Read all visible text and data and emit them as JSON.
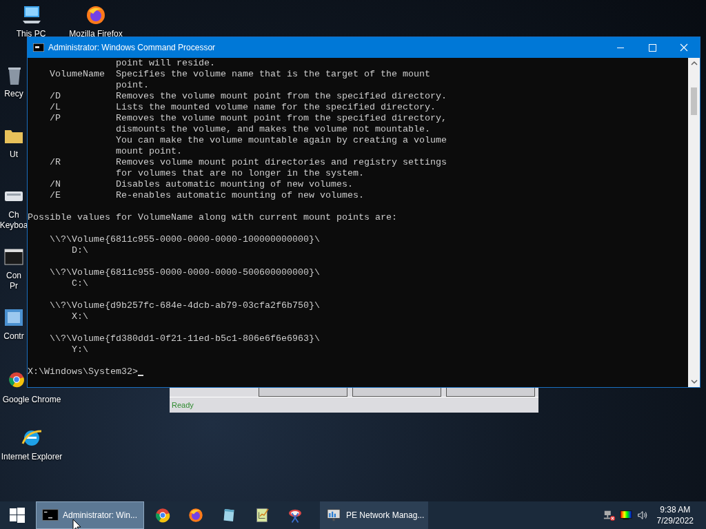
{
  "desktop_icons": [
    {
      "kind": "computer",
      "lines": [
        "This PC"
      ]
    },
    {
      "kind": "firefox",
      "lines": [
        "Mozilla Firefox"
      ]
    },
    {
      "kind": "recycle",
      "lines": [
        "Recy"
      ]
    },
    {
      "kind": "folder",
      "lines": [
        "Ut"
      ]
    },
    {
      "kind": "keyboard",
      "lines": [
        "Ch",
        "Keyboa"
      ]
    },
    {
      "kind": "console",
      "lines": [
        "Con",
        "Pr"
      ]
    },
    {
      "kind": "control",
      "lines": [
        "Contr"
      ]
    },
    {
      "kind": "chrome",
      "lines": [
        "Google Chrome"
      ]
    },
    {
      "kind": "ie",
      "lines": [
        "Internet Explorer"
      ]
    }
  ],
  "background_window": {
    "status": "Ready"
  },
  "console_window": {
    "title": "Administrator: Windows Command Processor",
    "options": [
      {
        "lines": [
          "point will reside."
        ]
      },
      {
        "switch": "VolumeName",
        "lines": [
          "Specifies the volume name that is the target of the mount",
          "point."
        ]
      },
      {
        "switch": "/D",
        "lines": [
          "Removes the volume mount point from the specified directory."
        ]
      },
      {
        "switch": "/L",
        "lines": [
          "Lists the mounted volume name for the specified directory."
        ]
      },
      {
        "switch": "/P",
        "lines": [
          "Removes the volume mount point from the specified directory,",
          "dismounts the volume, and makes the volume not mountable.",
          "You can make the volume mountable again by creating a volume",
          "mount point."
        ]
      },
      {
        "switch": "/R",
        "lines": [
          "Removes volume mount point directories and registry settings",
          "for volumes that are no longer in the system."
        ]
      },
      {
        "switch": "/N",
        "lines": [
          "Disables automatic mounting of new volumes."
        ]
      },
      {
        "switch": "/E",
        "lines": [
          "Re-enables automatic mounting of new volumes."
        ]
      }
    ],
    "heading": "Possible values for VolumeName along with current mount points are:",
    "volumes": [
      {
        "path": "\\\\?\\Volume{6811c955-0000-0000-0000-100000000000}\\",
        "drive": "D:\\"
      },
      {
        "path": "\\\\?\\Volume{6811c955-0000-0000-0000-500600000000}\\",
        "drive": "C:\\"
      },
      {
        "path": "\\\\?\\Volume{d9b257fc-684e-4dcb-ab79-03cfa2f6b750}\\",
        "drive": "X:\\"
      },
      {
        "path": "\\\\?\\Volume{fd380dd1-0f21-11ed-b5c1-806e6f6e6963}\\",
        "drive": "Y:\\"
      }
    ],
    "prompt": "X:\\Windows\\System32>"
  },
  "taskbar": {
    "tasks": [
      {
        "kind": "console",
        "label": "Administrator: Win...",
        "selected": true
      },
      {
        "kind": "network",
        "label": "PE Network Manag...",
        "selected": false
      }
    ],
    "clock": {
      "time": "9:38 AM",
      "date": "7/29/2022"
    }
  }
}
